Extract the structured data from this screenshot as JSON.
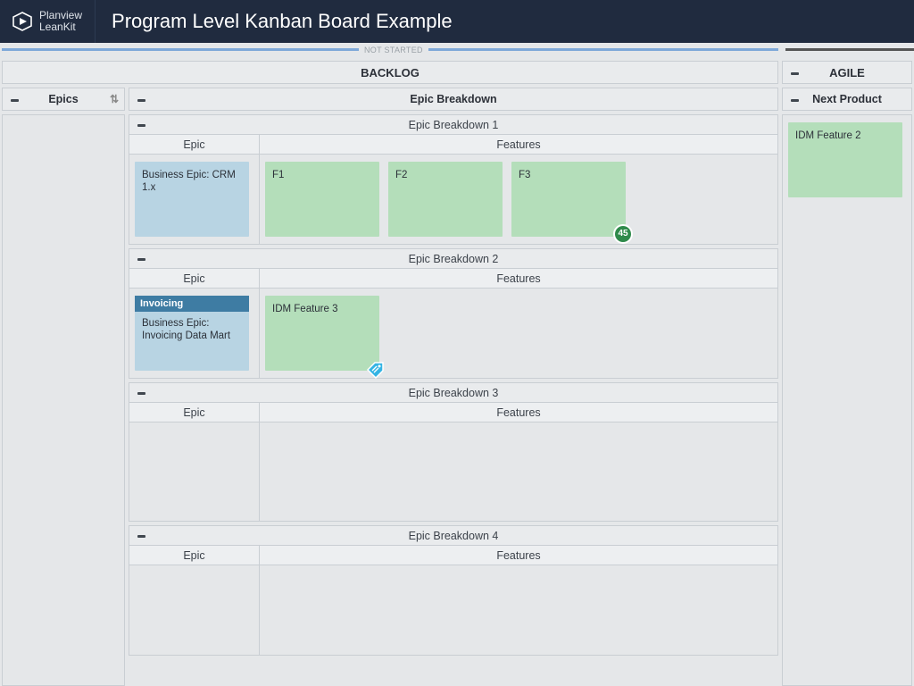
{
  "brand": {
    "line1": "Planview",
    "line2": "LeanKit"
  },
  "page_title": "Program Level Kanban Board Example",
  "status": {
    "not_started_label": "NOT STARTED"
  },
  "top_lanes": {
    "backlog": "BACKLOG",
    "agile": "AGILE"
  },
  "columns": {
    "epics": "Epics",
    "epic_breakdown": "Epic Breakdown",
    "next": "Next Product"
  },
  "eb": {
    "group1": {
      "title": "Epic Breakdown 1",
      "epic_header": "Epic",
      "feat_header": "Features",
      "epic_card": {
        "title": "Business Epic: CRM 1.x"
      },
      "features": {
        "f1": "F1",
        "f2": "F2",
        "f3": "F3",
        "f3_badge": "45"
      }
    },
    "group2": {
      "title": "Epic Breakdown 2",
      "epic_header": "Epic",
      "feat_header": "Features",
      "epic_card": {
        "tag": "Invoicing",
        "title": "Business Epic: Invoicing Data Mart"
      },
      "features": {
        "f1": "IDM Feature 3"
      }
    },
    "group3": {
      "title": "Epic Breakdown 3",
      "epic_header": "Epic",
      "feat_header": "Features"
    },
    "group4": {
      "title": "Epic Breakdown 4",
      "epic_header": "Epic",
      "feat_header": "Features"
    }
  },
  "next_column": {
    "card1": "IDM Feature 2"
  }
}
